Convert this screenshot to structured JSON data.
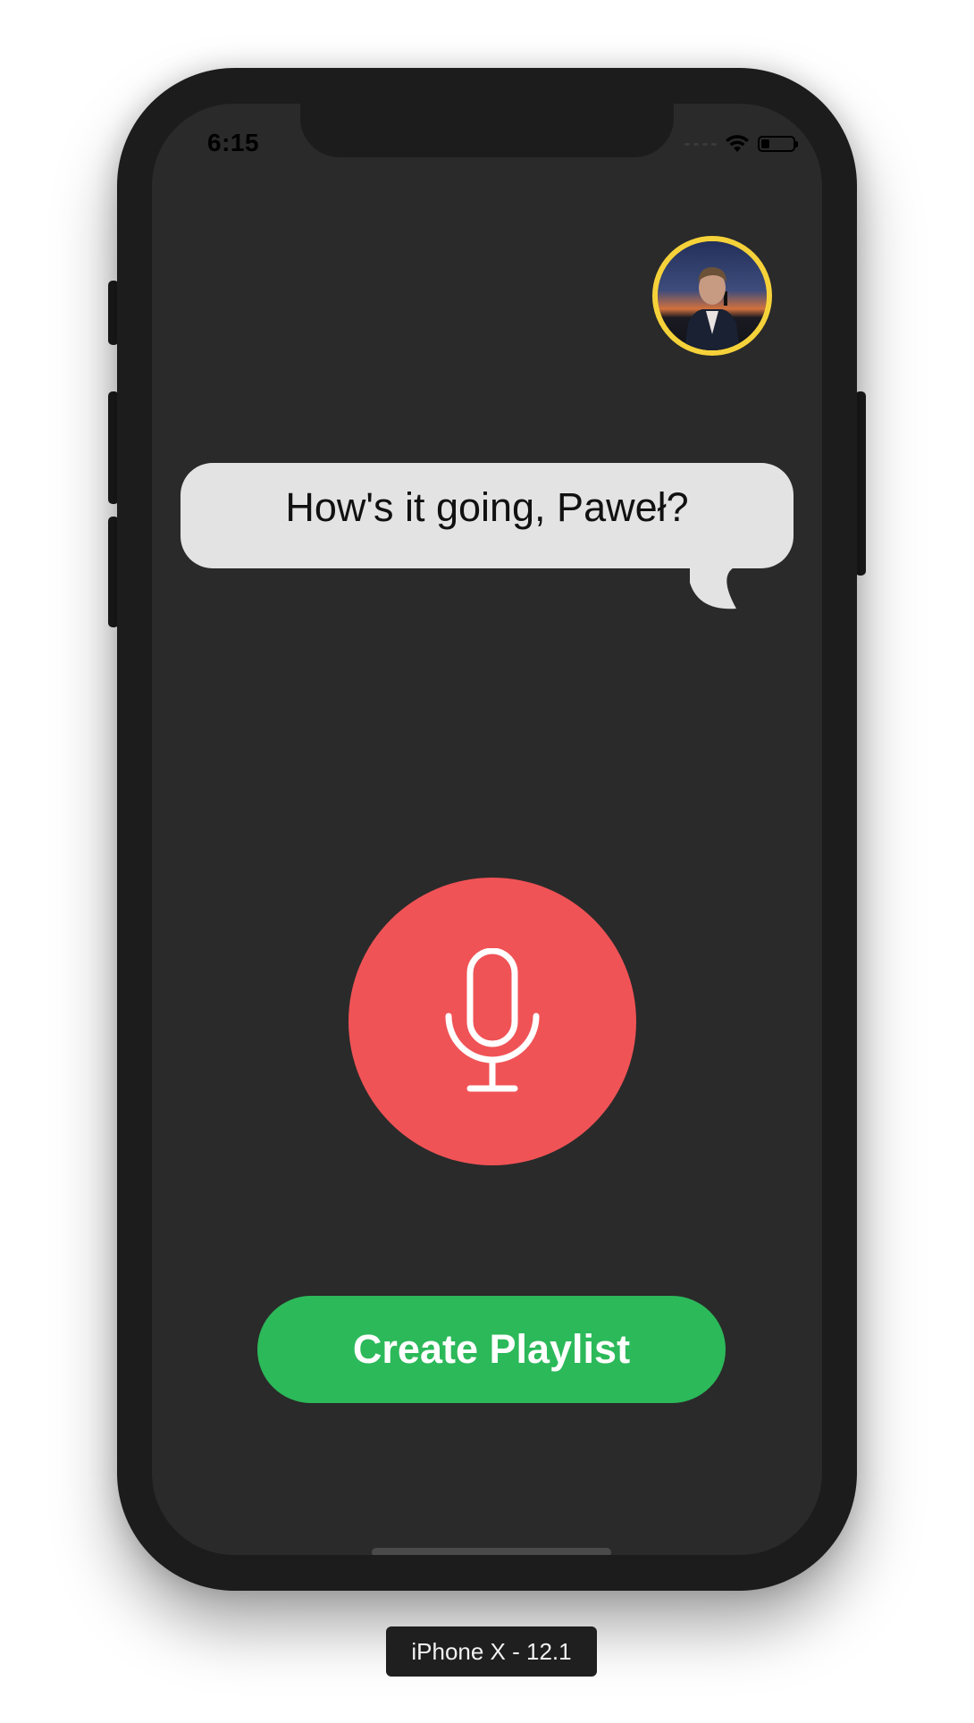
{
  "status_bar": {
    "time": "6:15",
    "battery_level": 0.25
  },
  "avatar": {
    "ring_color": "#f6d23a"
  },
  "greeting": {
    "text": "How's it going, Paweł?",
    "bubble_color": "#e3e3e3"
  },
  "mic_button": {
    "color": "#f05356",
    "icon": "microphone-icon"
  },
  "create_playlist": {
    "label": "Create Playlist",
    "color": "#2cb95a"
  },
  "device_caption": "iPhone X - 12.1"
}
